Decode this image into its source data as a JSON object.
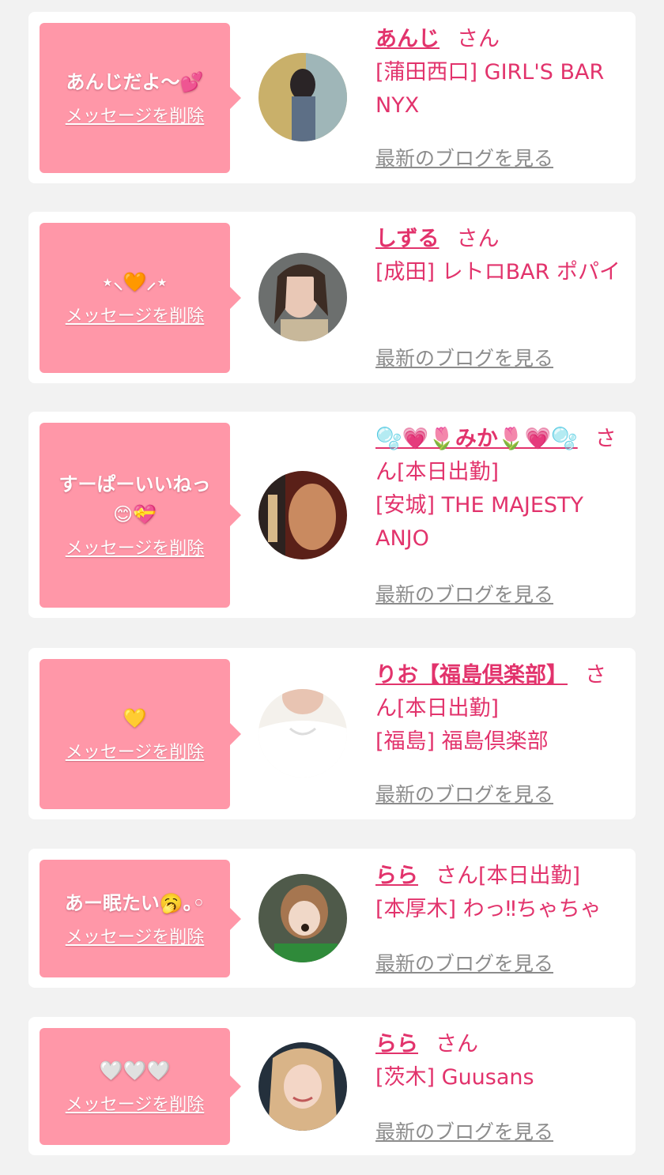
{
  "delete_label": "メッセージを削除",
  "blog_label": "最新のブログを見る",
  "san_label": "さん",
  "colors": {
    "background": "#f2f2f2",
    "bubble": "#ff97a8",
    "accent": "#e2336c",
    "link_gray": "#8c8c8c"
  },
  "items": [
    {
      "message": "あんじだよ〜💕",
      "name": "あんじ",
      "badge": "",
      "shop": "[蒲田西口] GIRL'S BAR NYX",
      "avatar_icon": "girl-photo-avatar"
    },
    {
      "message": "⋆⸜🧡⸝⋆",
      "name": "しずる",
      "badge": "",
      "shop": "[成田] レトロBAR ポパイ",
      "avatar_icon": "girl-photo-avatar"
    },
    {
      "message": "すーぱーいいねっ😊💝",
      "name": "🫧💗🌷みか🌷💗🫧",
      "badge": "[本日出勤]",
      "shop": "[安城] THE MAJESTY ANJO",
      "avatar_icon": "girl-photo-avatar"
    },
    {
      "message": "💛",
      "name": "りお【福島倶楽部】",
      "badge": "[本日出勤]",
      "shop": "[福島] 福島倶楽部",
      "avatar_icon": "girl-photo-avatar"
    },
    {
      "message": "あー眠たい🥱｡◦",
      "name": "らら",
      "badge": "[本日出勤]",
      "shop": "[本厚木] わっ‼ちゃちゃ",
      "avatar_icon": "girl-photo-avatar"
    },
    {
      "message": "🤍🤍🤍",
      "name": "らら",
      "badge": "",
      "shop": "[茨木] Guusans",
      "avatar_icon": "girl-photo-avatar"
    }
  ]
}
